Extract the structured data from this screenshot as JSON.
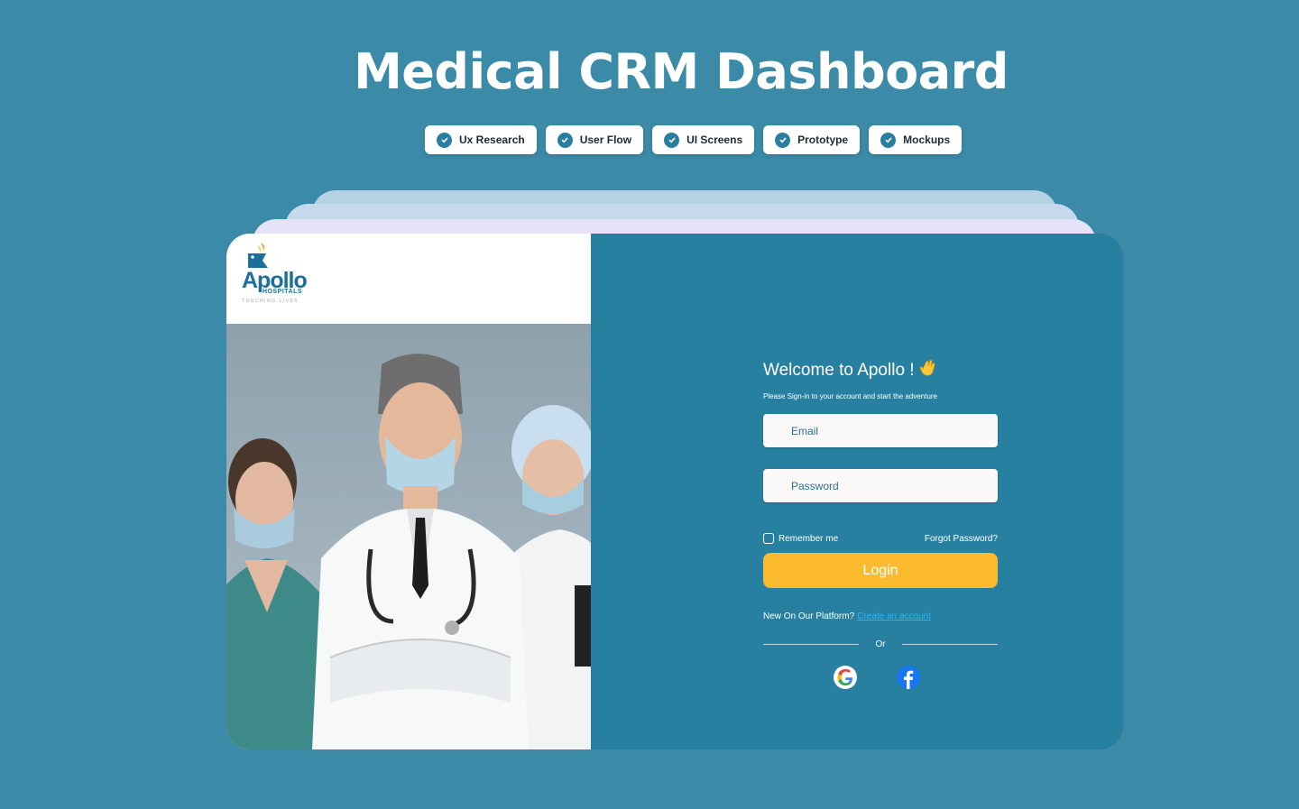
{
  "page": {
    "title": "Medical CRM Dashboard",
    "tags": [
      {
        "label": "Ux Research"
      },
      {
        "label": "User Flow"
      },
      {
        "label": "UI Screens"
      },
      {
        "label": "Prototype"
      },
      {
        "label": "Mockups"
      }
    ]
  },
  "brand": {
    "name": "Apollo",
    "sub": "HOSPITALS",
    "tagline": "TOUCHING LIVES"
  },
  "login": {
    "welcome": "Welcome to Apollo !",
    "wave_icon": "waving-hand-icon",
    "subtitle": "Please Sign-in to your account and start the adventure",
    "email_placeholder": "Email",
    "password_placeholder": "Password",
    "remember_label": "Remember me",
    "forgot_label": "Forgot Password?",
    "login_label": "Login",
    "new_text": "New On Our Platform?",
    "create_label": "Create an account",
    "or_label": "Or",
    "social": [
      {
        "icon": "google-icon"
      },
      {
        "icon": "facebook-icon"
      }
    ]
  },
  "colors": {
    "background": "#3a8aa8",
    "panel": "#27809f",
    "accent": "#fcbb2f",
    "link": "#2db3ff",
    "brand": "#1c6e9b"
  }
}
